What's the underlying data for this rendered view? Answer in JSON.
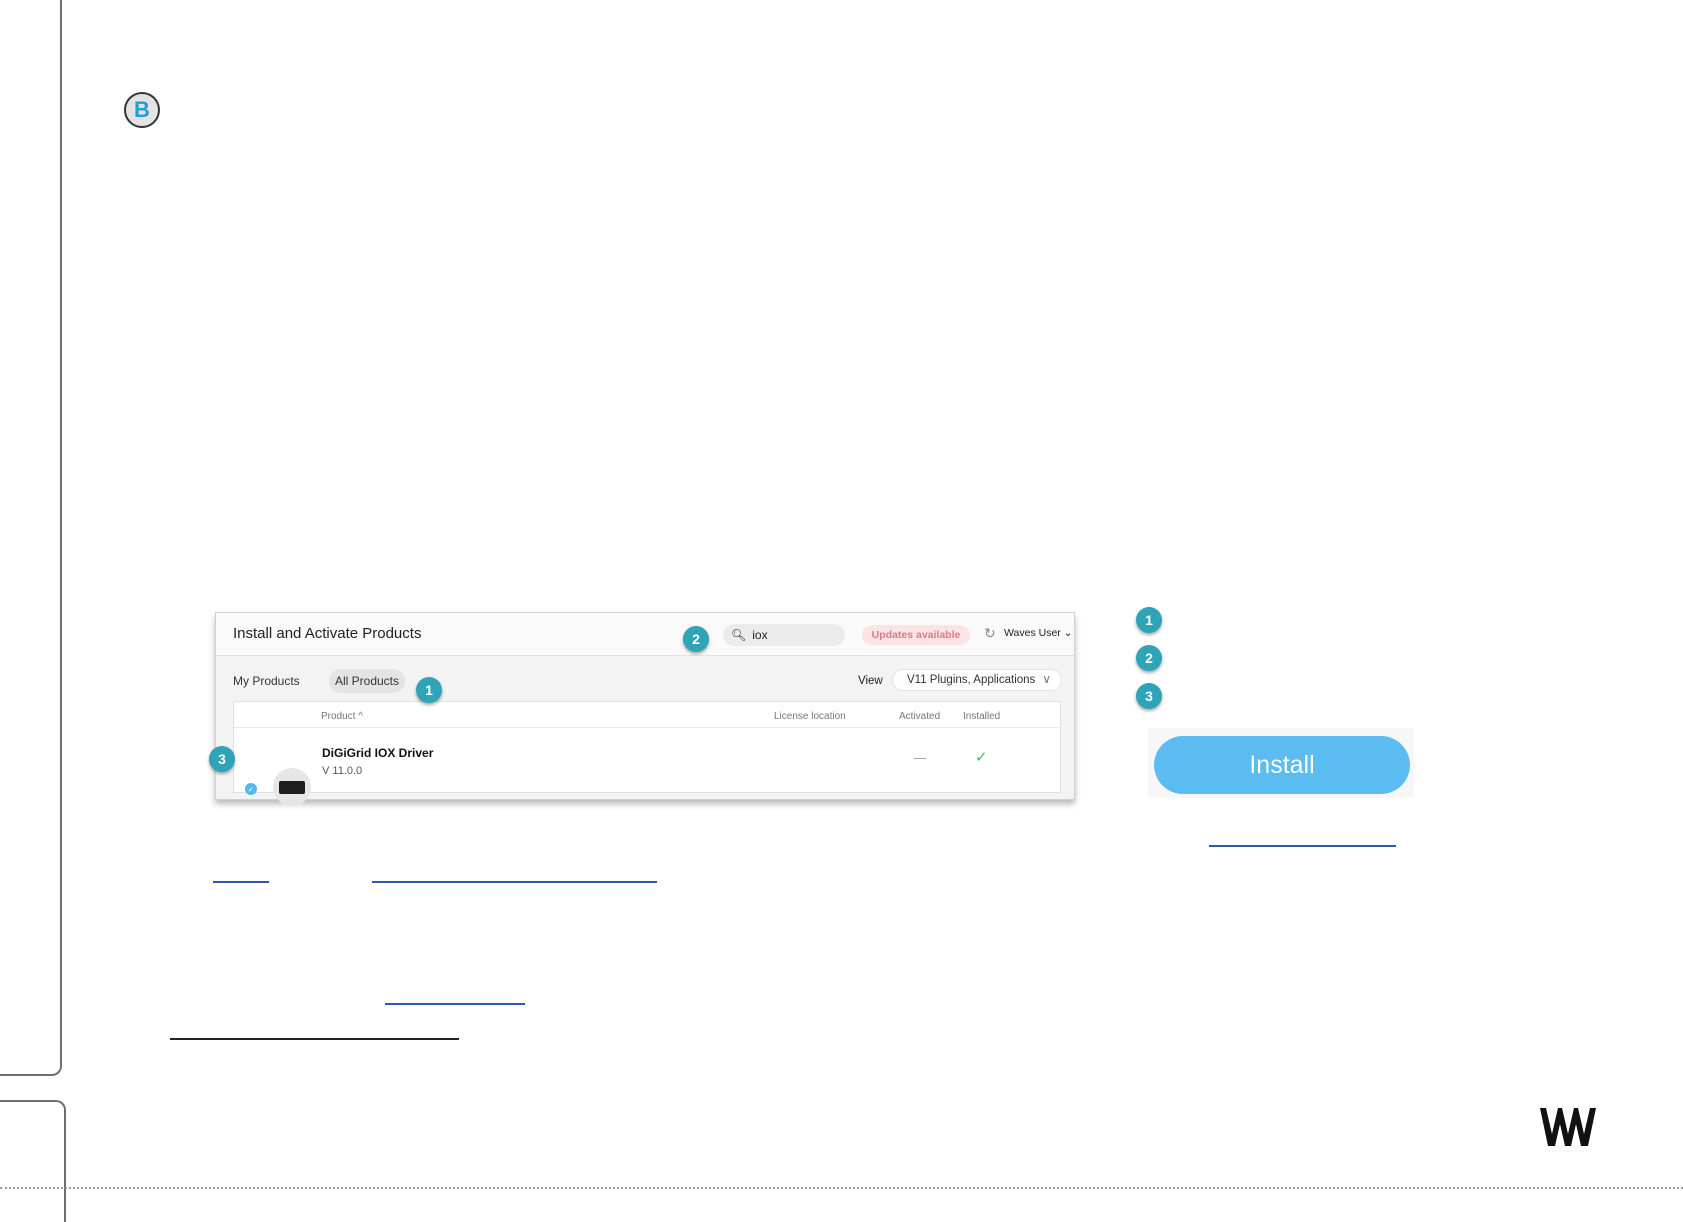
{
  "section": {
    "badge": "B"
  },
  "panel": {
    "title": "Install and Activate Products",
    "search": {
      "icon": "search-icon",
      "value": "iox"
    },
    "updates_label": "Updates available",
    "user_label": "Waves User",
    "tabs": {
      "my_products": "My Products",
      "all_products": "All Products"
    },
    "view": {
      "label": "View",
      "selected": "V11 Plugins, Applications"
    },
    "table": {
      "columns": {
        "product": "Product ^",
        "license_location": "License location",
        "activated": "Activated",
        "installed": "Installed"
      },
      "rows": [
        {
          "name": "DiGiGrid IOX Driver",
          "version": "V 11.0.0",
          "activated": "—",
          "installed": "✓"
        }
      ]
    }
  },
  "callouts": {
    "one": "1",
    "two": "2",
    "three": "3"
  },
  "install_button": {
    "label": "Install"
  },
  "colors": {
    "accent": "#5bbcf2",
    "callout": "#2fa3b7",
    "updates": "#e0788a",
    "installed": "#3dbb55"
  }
}
